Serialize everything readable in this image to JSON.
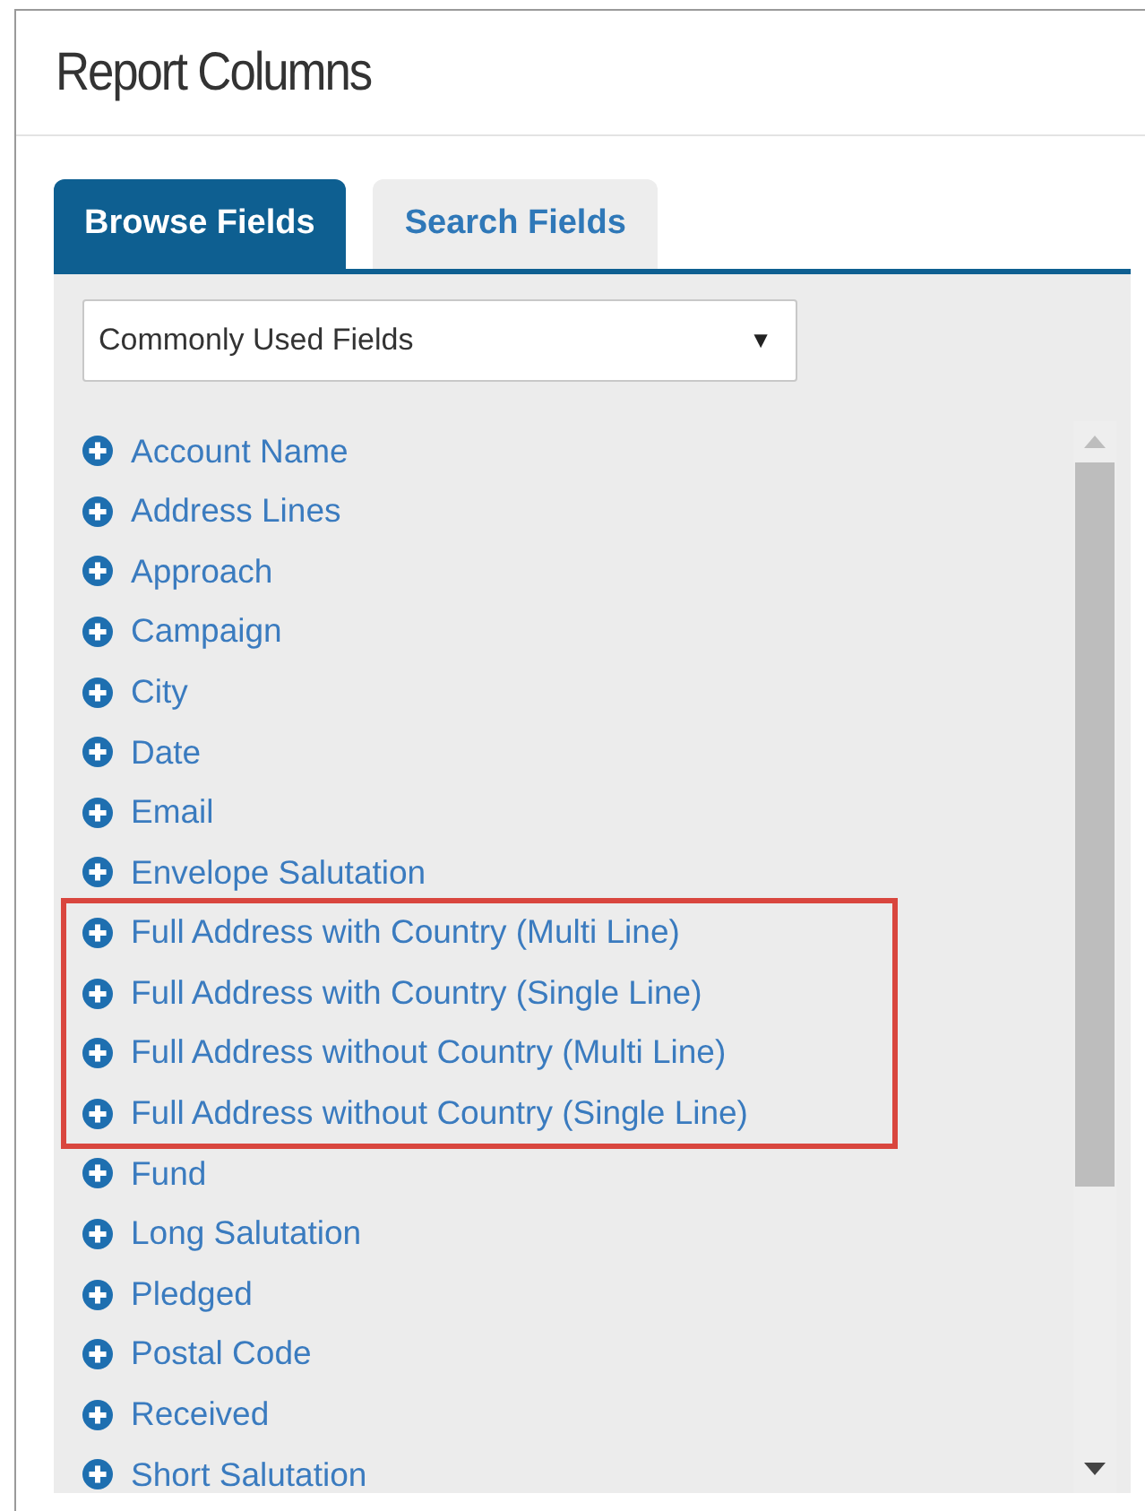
{
  "title": "Report Columns",
  "tabs": [
    {
      "label": "Browse Fields",
      "selected": true
    },
    {
      "label": "Search Fields",
      "selected": false
    }
  ],
  "category_select": {
    "value": "Commonly Used Fields",
    "arrow": "▼"
  },
  "fields": [
    {
      "label": "Account Name",
      "highlighted": false
    },
    {
      "label": "Address Lines",
      "highlighted": false
    },
    {
      "label": "Approach",
      "highlighted": false
    },
    {
      "label": "Campaign",
      "highlighted": false
    },
    {
      "label": "City",
      "highlighted": false
    },
    {
      "label": "Date",
      "highlighted": false
    },
    {
      "label": "Email",
      "highlighted": false
    },
    {
      "label": "Envelope Salutation",
      "highlighted": false
    },
    {
      "label": "Full Address with Country (Multi Line)",
      "highlighted": true
    },
    {
      "label": "Full Address with Country (Single Line)",
      "highlighted": true
    },
    {
      "label": "Full Address without Country (Multi Line)",
      "highlighted": true
    },
    {
      "label": "Full Address without Country (Single Line)",
      "highlighted": true
    },
    {
      "label": "Fund",
      "highlighted": false
    },
    {
      "label": "Long Salutation",
      "highlighted": false
    },
    {
      "label": "Pledged",
      "highlighted": false
    },
    {
      "label": "Postal Code",
      "highlighted": false
    },
    {
      "label": "Received",
      "highlighted": false
    },
    {
      "label": "Short Salutation",
      "highlighted": false
    }
  ]
}
